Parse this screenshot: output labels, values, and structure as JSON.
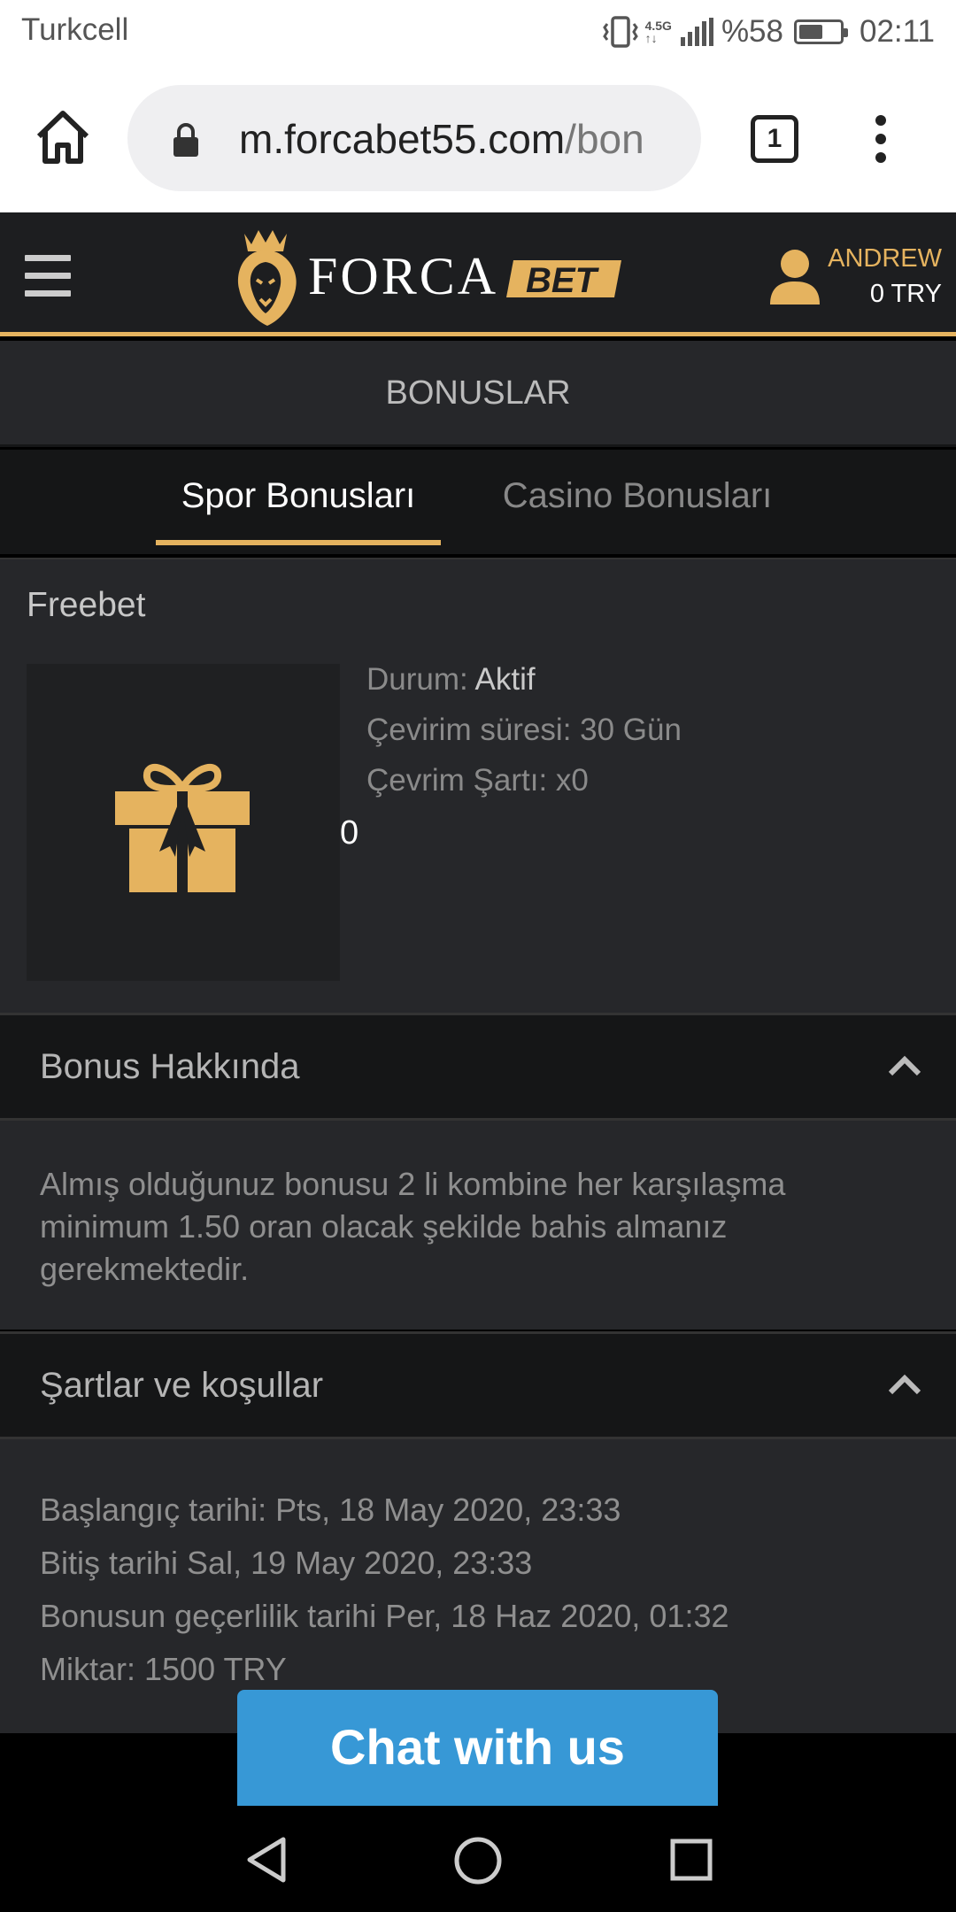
{
  "status_bar": {
    "carrier": "Turkcell",
    "network": "4.5G",
    "battery_text": "%58",
    "battery_level": 0.58,
    "time": "02:11"
  },
  "browser": {
    "url_domain": "m.forcabet55.com",
    "url_path": "/bon",
    "tab_count": "1"
  },
  "header": {
    "logo_forca": "FORCA",
    "logo_bet": "BET",
    "username": "ANDREW",
    "balance": "0 TRY"
  },
  "page": {
    "title": "BONUSLAR"
  },
  "tabs": [
    {
      "label": "Spor Bonusları",
      "active": true
    },
    {
      "label": "Casino Bonusları",
      "active": false
    }
  ],
  "bonus": {
    "name": "Freebet",
    "status_label": "Durum: ",
    "status_value": "Aktif",
    "period": "Çevirim süresi: 30 Gün",
    "condition": "Çevrim Şartı: x0",
    "amount_display": "0"
  },
  "about": {
    "title": "Bonus Hakkında",
    "text": "Almış olduğunuz bonusu 2 li kombine her karşılaşma minimum 1.50 oran olacak şekilde bahis almanız gerekmektedir."
  },
  "terms": {
    "title": "Şartlar ve koşullar",
    "start": "Başlangıç tarihi: Pts, 18 May 2020, 23:33",
    "end": "Bitiş tarihi Sal, 19 May 2020, 23:33",
    "valid": "Bonusun geçerlilik tarihi Per, 18 Haz 2020, 01:32",
    "amount": "Miktar: 1500 TRY"
  },
  "chat": {
    "label": "Chat with us"
  },
  "colors": {
    "accent": "#e5b35f",
    "chat": "#3798d6",
    "bg_dark": "#151617",
    "bg_card": "#26272a"
  }
}
